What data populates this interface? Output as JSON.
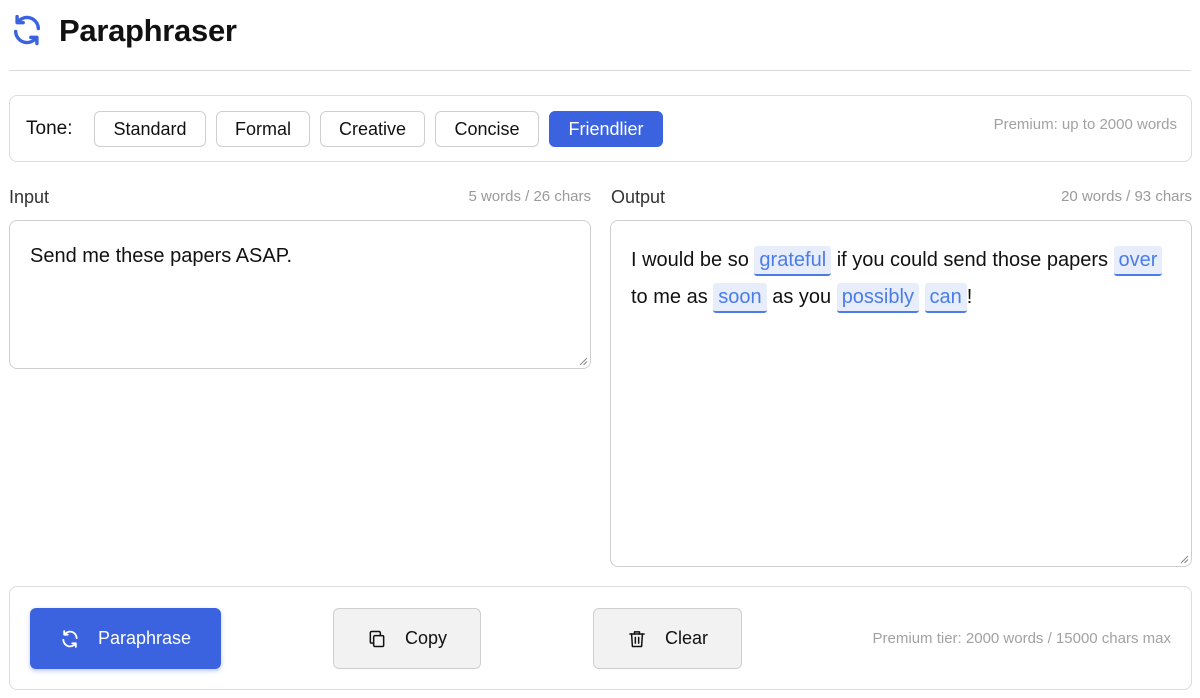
{
  "app": {
    "title": "Paraphraser"
  },
  "tone": {
    "label": "Tone:",
    "options": [
      "Standard",
      "Formal",
      "Creative",
      "Concise",
      "Friendlier"
    ],
    "selected": "Friendlier",
    "premium_note": "Premium: up to 2000 words"
  },
  "input": {
    "label": "Input",
    "count": "5 words / 26 chars",
    "text": "Send me these papers ASAP."
  },
  "output": {
    "label": "Output",
    "count": "20 words / 93 chars",
    "segments": [
      {
        "text": "I would be so ",
        "changed": false
      },
      {
        "text": "grateful",
        "changed": true
      },
      {
        "text": " if you could send those papers ",
        "changed": false
      },
      {
        "text": "over",
        "changed": true
      },
      {
        "text": " to me as ",
        "changed": false
      },
      {
        "text": "soon",
        "changed": true
      },
      {
        "text": " as you ",
        "changed": false
      },
      {
        "text": "possibly",
        "changed": true
      },
      {
        "text": " ",
        "changed": false
      },
      {
        "text": "can",
        "changed": true
      },
      {
        "text": "!",
        "changed": false
      }
    ]
  },
  "actions": {
    "paraphrase_label": "Paraphrase",
    "copy_label": "Copy",
    "clear_label": "Clear",
    "tier_note": "Premium tier: 2000 words / 15000 chars max"
  },
  "icons": {
    "logo": "refresh-icon",
    "paraphrase": "refresh-icon",
    "copy": "copy-icon",
    "clear": "trash-icon"
  },
  "colors": {
    "accent": "#3b63e0",
    "highlight_text": "#4a7de8",
    "highlight_bg": "#e7edfb"
  }
}
